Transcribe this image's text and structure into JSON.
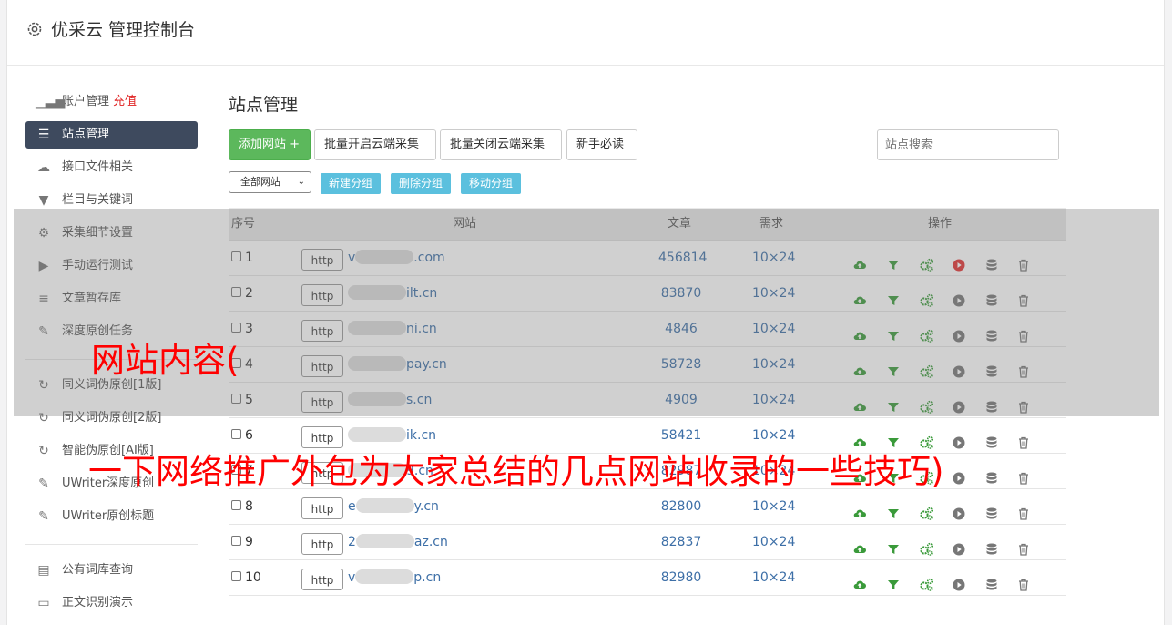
{
  "header": {
    "title": "优采云 管理控制台"
  },
  "sidebar": {
    "items": [
      {
        "label": "账户管理",
        "extra": "充值",
        "icon": "bar-chart-icon"
      },
      {
        "label": "站点管理",
        "icon": "server-icon",
        "active": true
      },
      {
        "label": "接口文件相关",
        "icon": "cloud-upload-icon"
      },
      {
        "label": "栏目与关键词",
        "icon": "filter-icon"
      },
      {
        "label": "采集细节设置",
        "icon": "gears-icon"
      },
      {
        "label": "手动运行测试",
        "icon": "play-circle-icon"
      },
      {
        "label": "文章暂存库",
        "icon": "database-icon"
      },
      {
        "label": "深度原创任务",
        "icon": "edit-icon"
      },
      {
        "label": "同义词伪原创[1版]",
        "icon": "refresh-icon"
      },
      {
        "label": "同义词伪原创[2版]",
        "icon": "refresh-icon"
      },
      {
        "label": "智能伪原创[AI版]",
        "icon": "refresh-icon"
      },
      {
        "label": "UWriter深度原创",
        "icon": "edit-icon"
      },
      {
        "label": "UWriter原创标题",
        "icon": "edit-icon"
      },
      {
        "label": "公有词库查询",
        "icon": "book-icon"
      },
      {
        "label": "正文识别演示",
        "icon": "monitor-icon"
      }
    ]
  },
  "main": {
    "title": "站点管理",
    "buttons": {
      "add": "添加网站 +",
      "batch_open": "批量开启云端采集",
      "batch_close": "批量关闭云端采集",
      "guide": "新手必读"
    },
    "search_placeholder": "站点搜索",
    "group_select": "全部网站",
    "group_buttons": {
      "new": "新建分组",
      "delete": "删除分组",
      "move": "移动分组"
    },
    "table": {
      "headers": {
        "num": "序号",
        "site": "网站",
        "articles": "文章",
        "demand": "需求",
        "ops": "操作"
      },
      "http_label": "http",
      "rows": [
        {
          "num": "1",
          "prefix": "v",
          "suffix": ".com",
          "articles": "456814",
          "demand": "10×24",
          "running": true
        },
        {
          "num": "2",
          "prefix": "",
          "suffix": "ilt.cn",
          "articles": "83870",
          "demand": "10×24",
          "running": false
        },
        {
          "num": "3",
          "prefix": "",
          "suffix": "ni.cn",
          "articles": "4846",
          "demand": "10×24",
          "running": false
        },
        {
          "num": "4",
          "prefix": "",
          "suffix": "pay.cn",
          "articles": "58728",
          "demand": "10×24",
          "running": false
        },
        {
          "num": "5",
          "prefix": "",
          "suffix": "s.cn",
          "articles": "4909",
          "demand": "10×24",
          "running": false
        },
        {
          "num": "6",
          "prefix": "",
          "suffix": "ik.cn",
          "articles": "58421",
          "demand": "10×24",
          "running": false
        },
        {
          "num": "7",
          "prefix": "",
          "suffix": "9.cn",
          "articles": "82987",
          "demand": "10×24",
          "running": false
        },
        {
          "num": "8",
          "prefix": "e",
          "suffix": "y.cn",
          "articles": "82800",
          "demand": "10×24",
          "running": false
        },
        {
          "num": "9",
          "prefix": "2",
          "suffix": "az.cn",
          "articles": "82837",
          "demand": "10×24",
          "running": false
        },
        {
          "num": "10",
          "prefix": "v",
          "suffix": "p.cn",
          "articles": "82980",
          "demand": "10×24",
          "running": false
        }
      ]
    }
  },
  "overlay": {
    "line1": "网站内容(",
    "line2": "一下网络推广外包为大家总结的几点网站收录的一些技巧)"
  },
  "colors": {
    "accent_green": "#5cb85c",
    "info_blue": "#5bc0de",
    "active_nav": "#3e4a5e",
    "link_blue": "#3d6fa7",
    "overlay_red": "#ff0000"
  }
}
